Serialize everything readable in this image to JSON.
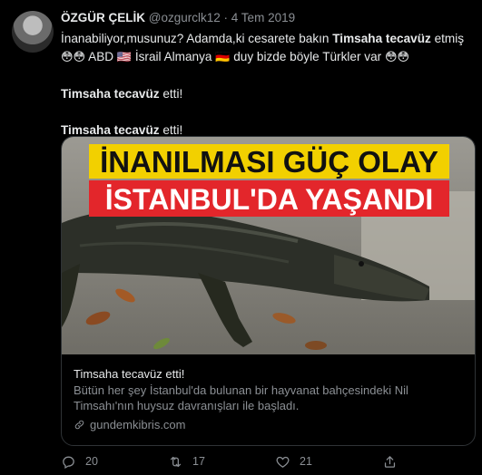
{
  "tweet": {
    "author_name": "ÖZGÜR ÇELİK",
    "handle": "@ozgurclk12",
    "separator": "·",
    "date": "4 Tem 2019",
    "line1_a": "İnanabiliyor,musunuz? Adamda,ki cesarete bakın ",
    "line1_bold": "Timsaha tecavüz",
    "line1_b": " etmiş",
    "line2_emoji_a": "😳😳",
    "line2_a": " ABD ",
    "line2_flag_us": "🇺🇸",
    "line2_b": " İsrail Almanya ",
    "line2_flag_de": "🇩🇪",
    "line2_c": " duy bizde böyle Türkler var ",
    "line2_emoji_b": "😳😳",
    "p2_bold": "Timsaha tecavüz",
    "p2_rest": " etti!",
    "p3_bold": "Timsaha tecavüz",
    "p3_rest": " etti!"
  },
  "card": {
    "image_headline_1": "İNANILMASI GÜÇ OLAY",
    "image_headline_2": "İSTANBUL'DA YAŞANDI",
    "title": "Timsaha tecavüz etti!",
    "description": "Bütün her şey İstanbul'da bulunan bir hayvanat bahçesindeki Nil Timsahı'nın huysuz davranışları ile başladı.",
    "domain": "gundemkibris.com"
  },
  "actions": {
    "replies": "20",
    "retweets": "17",
    "likes": "21"
  },
  "colors": {
    "background": "#000000",
    "text": "#e7e9ea",
    "muted": "#8b8f94",
    "headline_yellow": "#f2d000",
    "headline_red": "#e3262b"
  }
}
